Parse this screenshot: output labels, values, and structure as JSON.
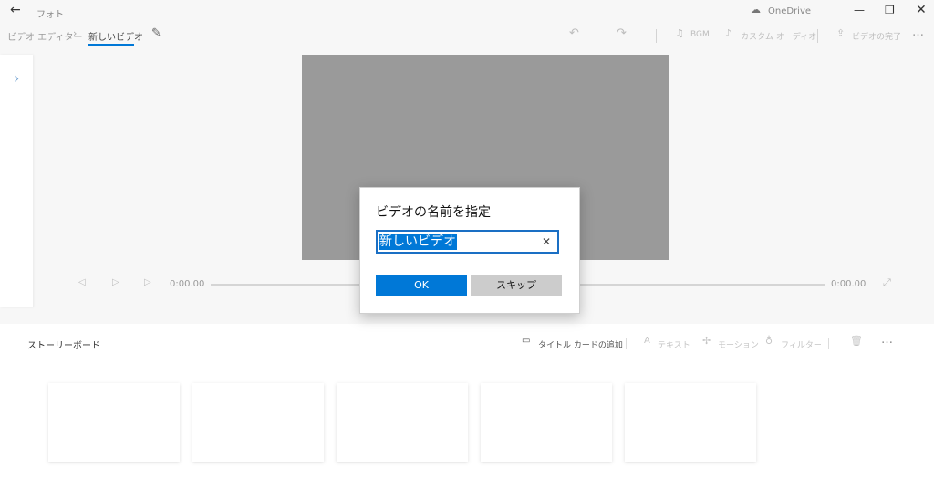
{
  "titlebar": {
    "back_icon": "back-arrow-icon",
    "app_name": "フォト",
    "onedrive_label": "OneDrive",
    "minimize_icon": "minimize-icon",
    "restore_icon": "restore-icon",
    "close_icon": "close-icon"
  },
  "header": {
    "breadcrumb_root": "ビデオ エディター",
    "breadcrumb_current": "新しいビデオ",
    "edit_icon": "pencil-icon",
    "bgm_label": "BGM",
    "custom_audio_label": "カスタム オーディオ",
    "finish_label": "ビデオの完了",
    "more_label": "…"
  },
  "player": {
    "time_current": "0:00.00",
    "time_total": "0:00.00"
  },
  "storyboard": {
    "title": "ストーリーボード",
    "add_title_card_label": "タイトル カードの追加",
    "text_label": "テキスト",
    "motion_label": "モーション",
    "filter_label": "フィルター",
    "more_label": "…",
    "cards": [
      {},
      {},
      {},
      {},
      {}
    ]
  },
  "dialog": {
    "title": "ビデオの名前を指定",
    "input_value": "新しいビデオ",
    "clear_label": "✕",
    "ok_label": "OK",
    "skip_label": "スキップ"
  },
  "colors": {
    "accent": "#0078d7",
    "background": "#f7f7f7",
    "preview": "#9a9a9a"
  }
}
